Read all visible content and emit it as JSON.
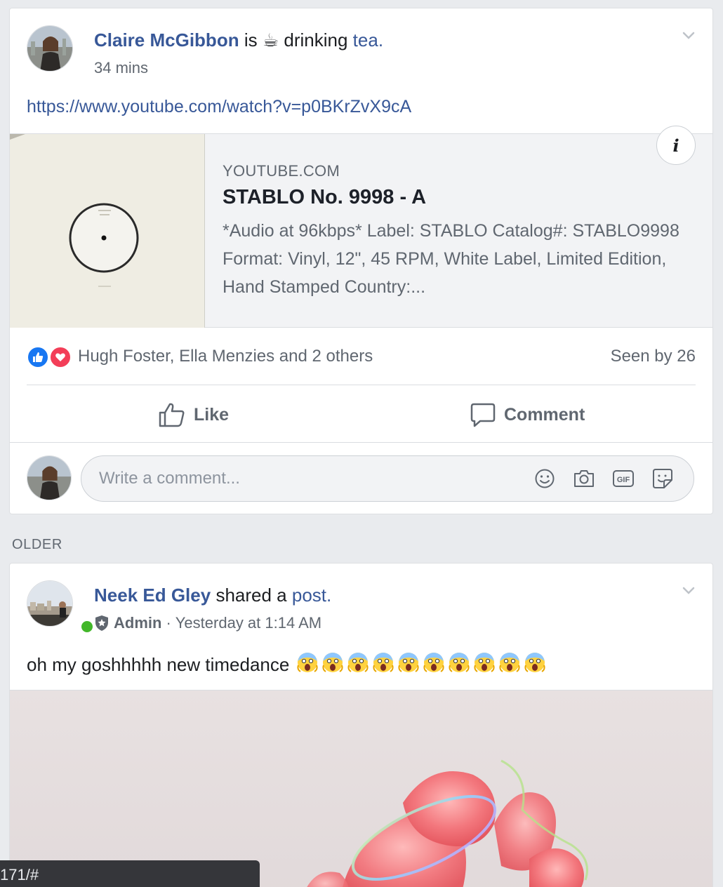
{
  "post1": {
    "author": "Claire McGibbon",
    "activity_prefix": "is",
    "activity_emoji": "☕",
    "activity_verb": "drinking",
    "activity_object": "tea.",
    "time": "34 mins",
    "url": "https://www.youtube.com/watch?v=p0BKrZvX9cA",
    "preview": {
      "domain": "YOUTUBE.COM",
      "title": "STABLO No. 9998 - A",
      "description": "*Audio at 96kbps* Label: STABLO Catalog#: STABLO9998 Format: Vinyl, 12\", 45 RPM, White Label, Limited Edition, Hand Stamped Country:..."
    },
    "reactions": {
      "names": "Hugh Foster, Ella Menzies and 2 others",
      "seen": "Seen by 26"
    },
    "actions": {
      "like": "Like",
      "comment": "Comment"
    },
    "comment_placeholder": "Write a comment..."
  },
  "section_label": "OLDER",
  "post2": {
    "author": "Neek Ed Gley",
    "shared_text": "shared a",
    "shared_link": "post.",
    "role": "Admin",
    "separator": "·",
    "time": "Yesterday at 1:14 AM",
    "text": "oh my goshhhhh new timedance",
    "emoji_count": 10
  },
  "statusbar": {
    "url": "171/#"
  }
}
